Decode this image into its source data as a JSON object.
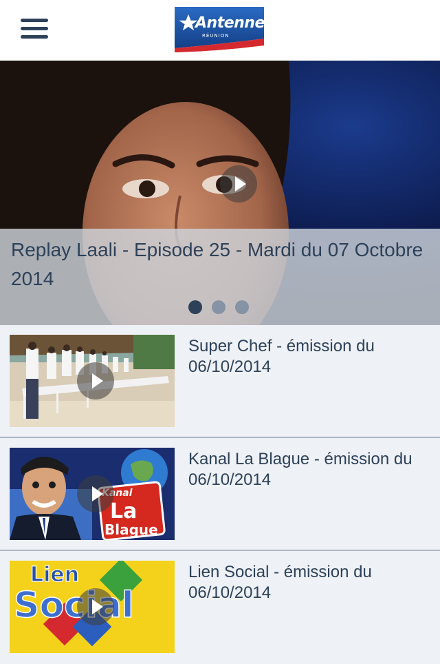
{
  "header": {
    "logo_text": "Antenne",
    "logo_subtext": "RÉUNION",
    "menu_icon": "hamburger-menu-icon"
  },
  "hero": {
    "title": "Replay Laali - Episode 25 - Mardi du 07 Octobre 2014",
    "play_icon": "play-icon",
    "pagination": {
      "total": 3,
      "active": 1
    }
  },
  "videos": [
    {
      "title": "Super Chef - émission du 06/10/2014"
    },
    {
      "title": "Kanal La Blague - émission du 06/10/2014",
      "thumb_text_1": "Kanal",
      "thumb_text_2": "La",
      "thumb_text_3": "Blague"
    },
    {
      "title": "Lien Social - émission du 06/10/2014",
      "thumb_text_1": "Lien",
      "thumb_text_2": "Social"
    }
  ],
  "colors": {
    "accent": "#2d4159",
    "background": "#eef1f5",
    "caption_overlay": "#cdd3db",
    "divider": "#a9b6c4",
    "logo_blue": "#1d4f9c",
    "logo_red": "#d42a2f"
  }
}
